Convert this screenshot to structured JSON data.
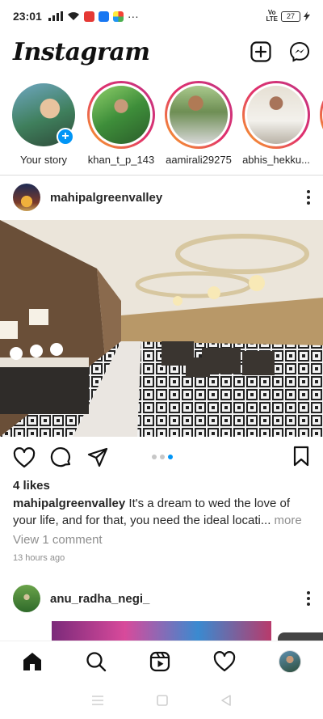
{
  "status_bar": {
    "time": "23:01",
    "more": "···",
    "volte": "Vo\nLTE",
    "battery": "27"
  },
  "header": {
    "logo": "Instagram"
  },
  "stories": [
    {
      "label": "Your story",
      "own": true
    },
    {
      "label": "khan_t_p_143",
      "own": false
    },
    {
      "label": "aamirali29275",
      "own": false
    },
    {
      "label": "abhis_hekku...",
      "own": false
    }
  ],
  "post1": {
    "username": "mahipalgreenvalley",
    "likes": "4 likes",
    "caption_user": "mahipalgreenvalley",
    "caption_text": " It's a dream to wed the love of your life, and for that, you need the ideal locati...",
    "caption_more": " more",
    "view_comments": "View 1 comment",
    "time_ago": "13 hours ago",
    "carousel": {
      "count": 3,
      "active_index": 2
    }
  },
  "post2": {
    "username": "anu_radha_negi_"
  },
  "colors": {
    "accent": "#0095f6",
    "text": "#262626",
    "muted": "#8e8e8e"
  }
}
